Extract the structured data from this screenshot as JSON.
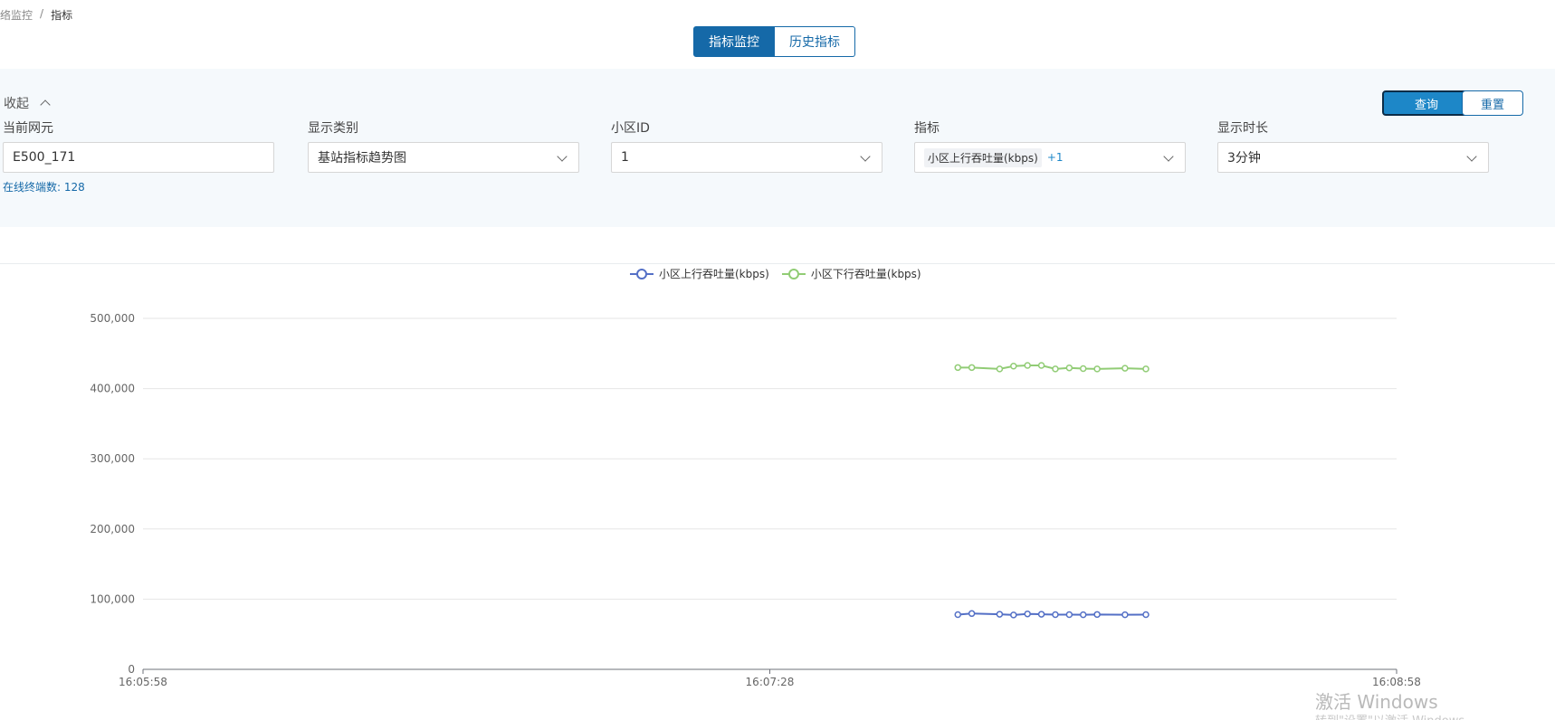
{
  "breadcrumb": {
    "parent": "络监控",
    "separator": "/",
    "current": "指标"
  },
  "tabs": [
    {
      "label": "指标监控"
    },
    {
      "label": "历史指标"
    }
  ],
  "panel": {
    "collapse_label": "收起",
    "query_label": "查询",
    "reset_label": "重置",
    "fields": {
      "element": {
        "label": "当前网元",
        "value": "E500_171"
      },
      "display_type": {
        "label": "显示类别",
        "value": "基站指标趋势图"
      },
      "cell_id": {
        "label": "小区ID",
        "value": "1"
      },
      "metric": {
        "label": "指标",
        "value": "小区上行吞吐量(kbps)",
        "more": "+1"
      },
      "duration": {
        "label": "显示时长",
        "value": "3分钟"
      }
    },
    "online_terminals": "在线终端数: 128"
  },
  "colors": {
    "accent": "#1569a8",
    "series_up": "#5470c6",
    "series_down": "#91cc75"
  },
  "chart_data": {
    "type": "line",
    "ylim": [
      0,
      500000
    ],
    "y_ticks": [
      "500,000",
      "400,000",
      "300,000",
      "200,000",
      "100,000",
      "0"
    ],
    "x_ticks": [
      "16:05:58",
      "16:07:28",
      "16:08:58"
    ],
    "x_range_seconds": [
      0,
      180
    ],
    "x_seconds": [
      117,
      119,
      123,
      125,
      127,
      129,
      131,
      133,
      135,
      137,
      141,
      144
    ],
    "series": [
      {
        "name": "小区上行吞吐量(kbps)",
        "color": "#5470c6",
        "values": [
          78000,
          79500,
          78500,
          77500,
          79000,
          78500,
          78000,
          78000,
          77800,
          78200,
          77800,
          78000
        ]
      },
      {
        "name": "小区下行吞吐量(kbps)",
        "color": "#91cc75",
        "values": [
          430000,
          430000,
          428000,
          432000,
          433000,
          433000,
          428000,
          429500,
          428500,
          428000,
          429000,
          428000
        ]
      }
    ]
  },
  "watermark": {
    "line1": "激活 Windows",
    "line2": "转到\"设置\"以激活 Windows。"
  }
}
